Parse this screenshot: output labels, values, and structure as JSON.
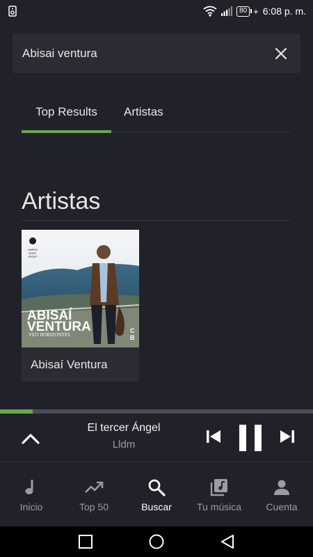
{
  "status_bar": {
    "battery_level": "80",
    "charging_symbol": "+",
    "time": "6:08 p. m."
  },
  "search": {
    "query": "Abisai ventura",
    "clear_icon": "close-icon"
  },
  "tabs": [
    {
      "label": "Top Results",
      "active": true
    },
    {
      "label": "Artistas",
      "active": false
    }
  ],
  "section": {
    "title": "Artistas"
  },
  "artist_card": {
    "name": "Abisaí Ventura",
    "cover": {
      "title_line1": "ABISAÍ",
      "title_line2": "VENTURA",
      "subtitle": "VEO HORIZONTES",
      "logo_text_1": "HARRA",
      "logo_text_2": "MUSIC",
      "logo_text_3": "GROUP",
      "corner_mark_1": "C",
      "corner_mark_2": "B"
    }
  },
  "player": {
    "progress": 0.105,
    "track_title": "El tercer Ángel",
    "track_artist": "Lldm"
  },
  "bottom_nav": [
    {
      "label": "Inicio",
      "icon": "music-note-icon",
      "active": false
    },
    {
      "label": "Top 50",
      "icon": "trending-up-icon",
      "active": false
    },
    {
      "label": "Buscar",
      "icon": "search-icon",
      "active": true
    },
    {
      "label": "Tu música",
      "icon": "library-music-icon",
      "active": false
    },
    {
      "label": "Cuenta",
      "icon": "person-icon",
      "active": false
    }
  ],
  "colors": {
    "background": "#212229",
    "surface": "#2b2c33",
    "accent": "#6aa84f",
    "text_primary": "#e6e6e6",
    "text_secondary": "#9a9ba3"
  }
}
